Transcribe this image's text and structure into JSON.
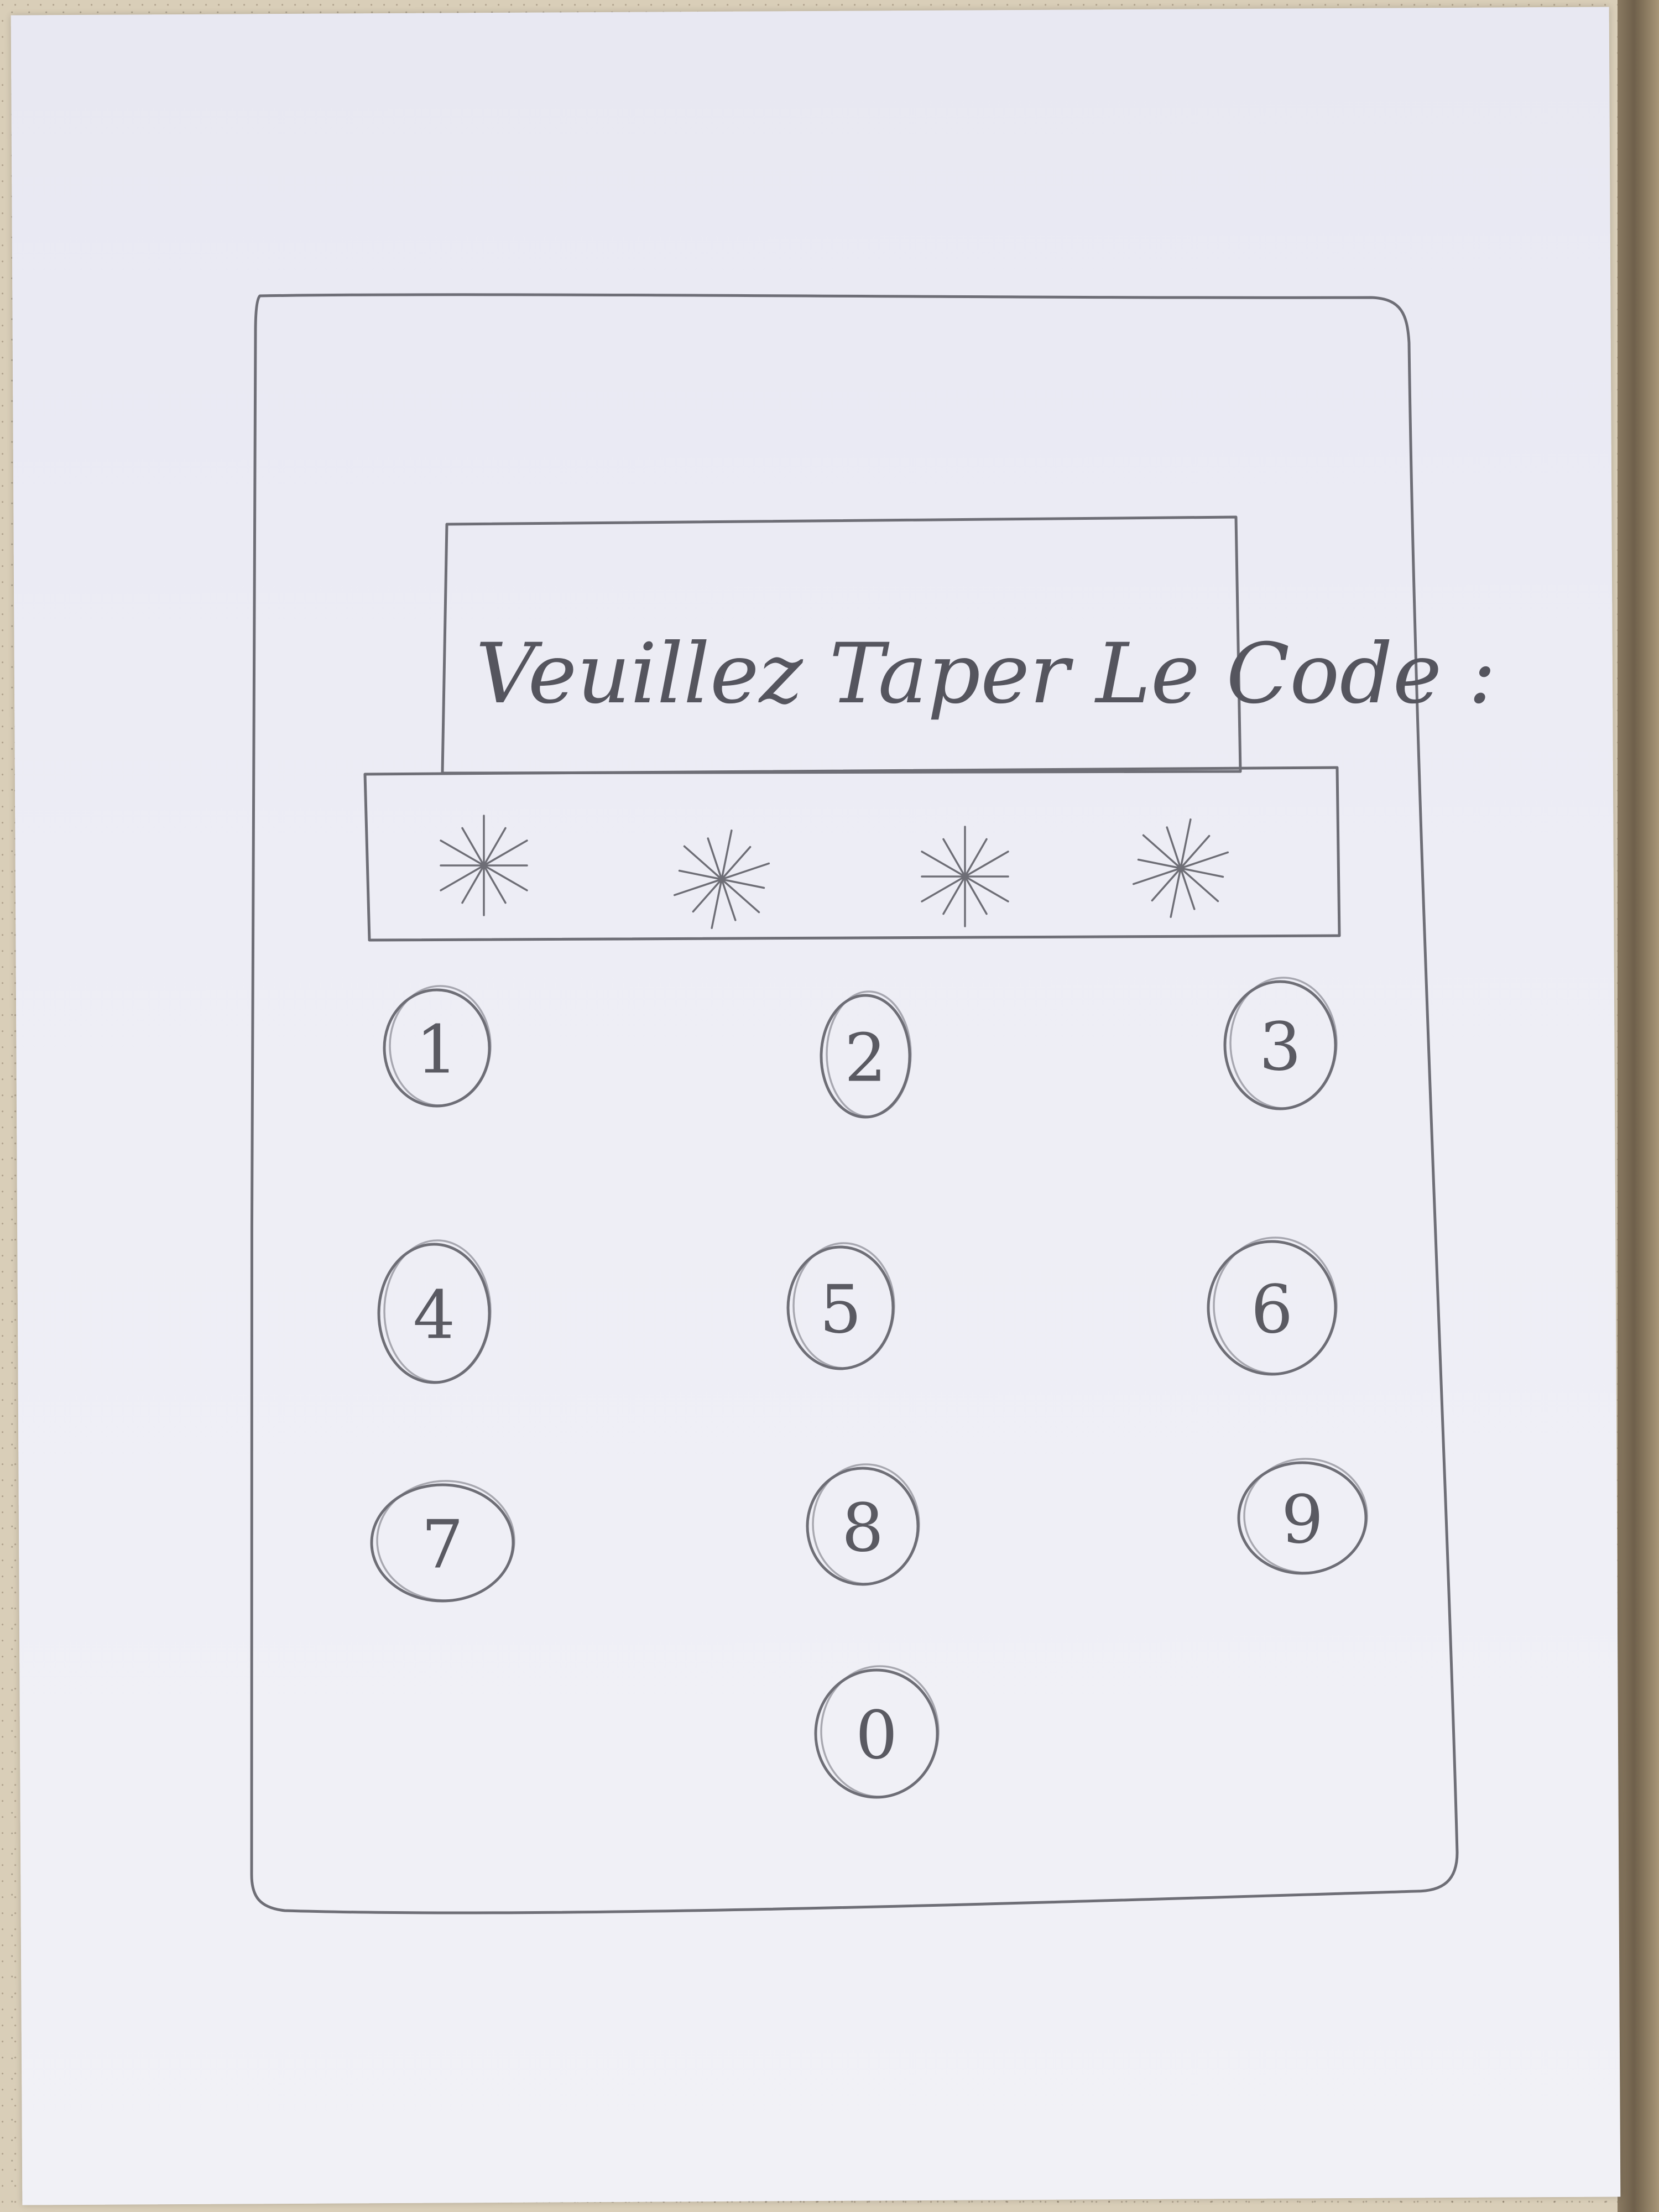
{
  "prompt": {
    "text": "Veuillez Taper Le Code :"
  },
  "code_display": {
    "masked_digits": [
      "*",
      "*",
      "*",
      "*"
    ]
  },
  "keypad": {
    "keys": [
      {
        "label": "1",
        "icon": "circle"
      },
      {
        "label": "2",
        "icon": "circle"
      },
      {
        "label": "3",
        "icon": "circle"
      },
      {
        "label": "4",
        "icon": "circle"
      },
      {
        "label": "5",
        "icon": "circle"
      },
      {
        "label": "6",
        "icon": "circle"
      },
      {
        "label": "7",
        "icon": "circle"
      },
      {
        "label": "8",
        "icon": "circle"
      },
      {
        "label": "9",
        "icon": "circle"
      },
      {
        "label": "0",
        "icon": "circle"
      }
    ]
  },
  "colors": {
    "pencil": "#6e6e76",
    "paper": "#ededf5",
    "table": "#d9ceb8"
  }
}
